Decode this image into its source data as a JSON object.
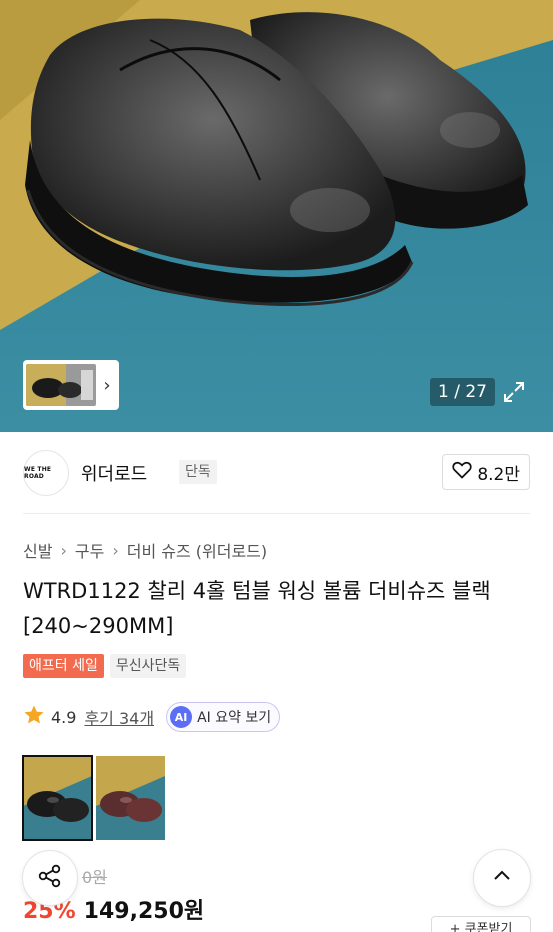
{
  "gallery": {
    "counter": "1 / 27",
    "thumb_nav_icon": "chevron-right-icon",
    "expand_icon": "expand-icon"
  },
  "brand": {
    "logo_text": "WE THE ROAD",
    "name": "위더로드",
    "tag": "단독",
    "like_count": "8.2만"
  },
  "breadcrumb": {
    "items": [
      "신발",
      "구두",
      "더비 슈즈 (위더로드)"
    ]
  },
  "product": {
    "title": "WTRD1122 찰리 4홀 텀블 워싱 볼륨 더비슈즈 블랙 [240~290MM]",
    "badges": [
      "애프터 세일",
      "무신사단독"
    ],
    "rating": "4.9",
    "reviews": "후기 34개",
    "ai_badge": "AI",
    "ai_summary": "AI 요약 보기",
    "original_price": "0원",
    "discount": "25%",
    "price": "149,250원"
  },
  "actions": {
    "coupon": "+ 쿠폰받기"
  },
  "colors": {
    "accent_sale": "#f26b4f",
    "discount": "#f2462e",
    "ai": "#5b6ef5"
  }
}
